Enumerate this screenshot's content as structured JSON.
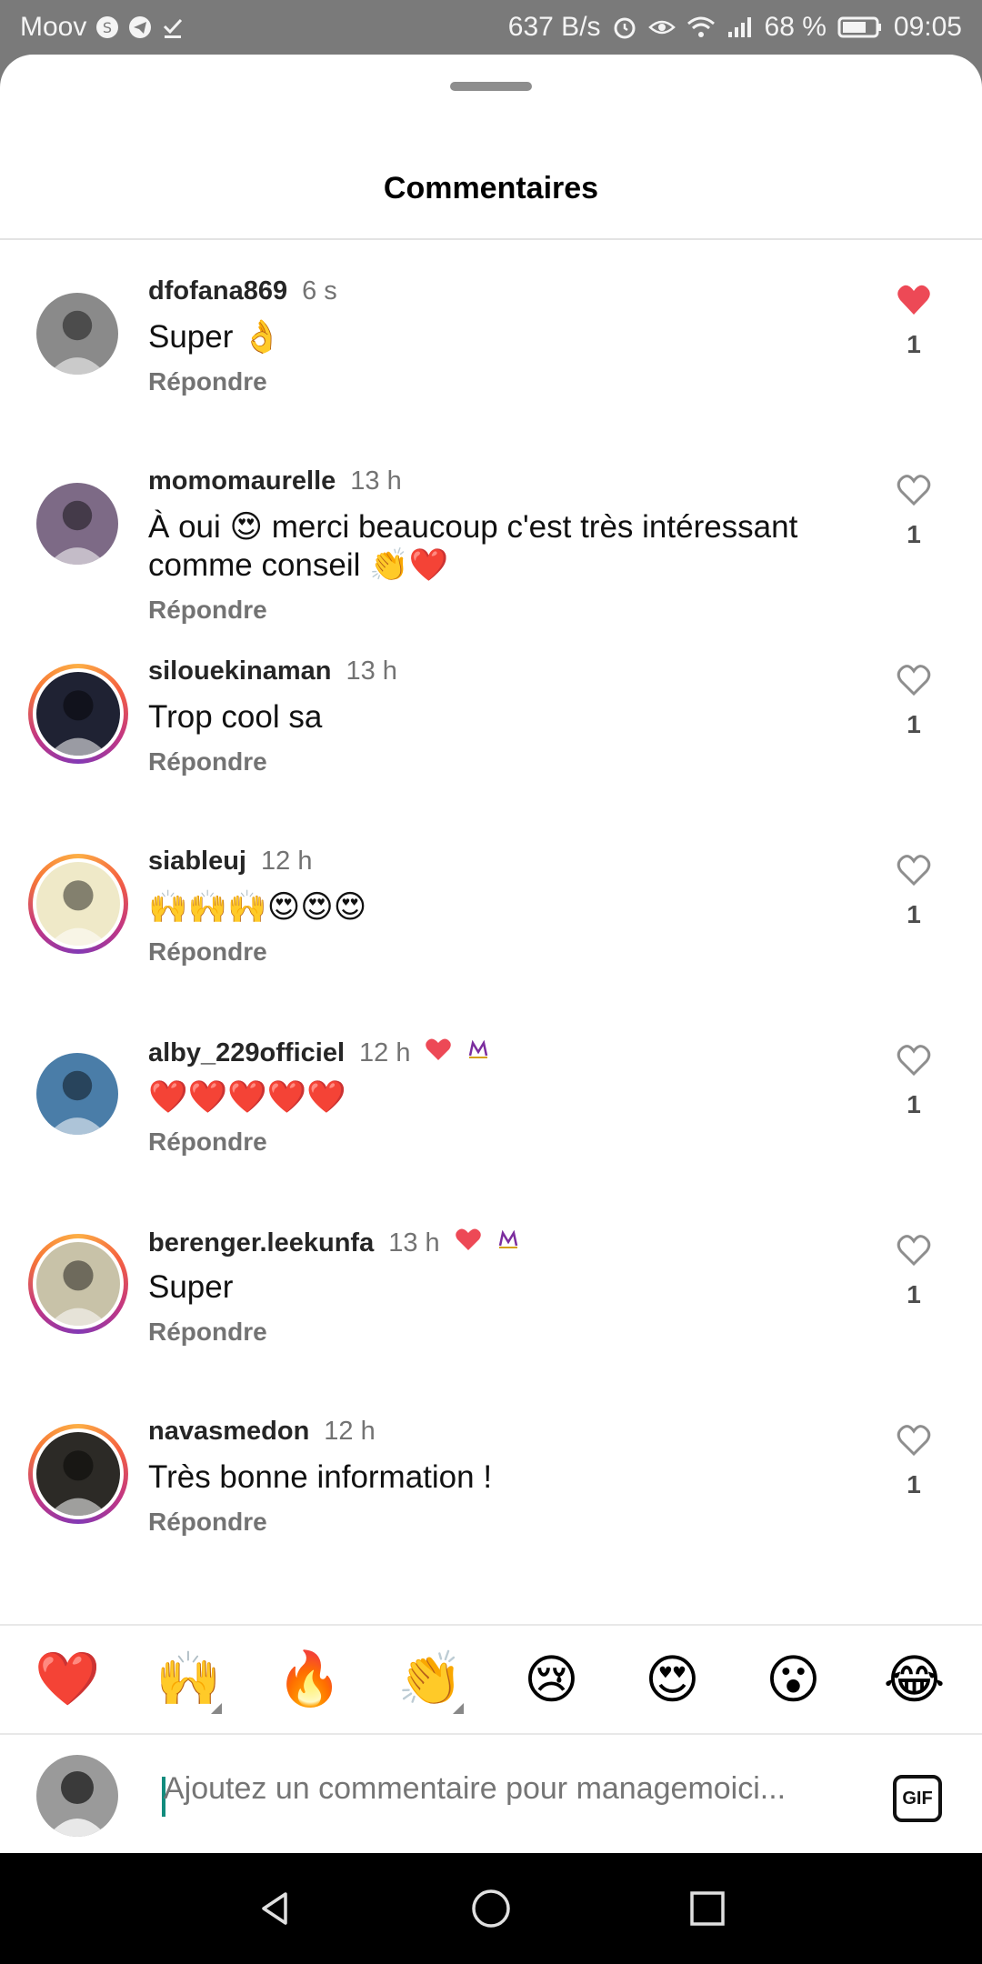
{
  "status_bar": {
    "carrier": "Moov",
    "net_speed": "637 B/s",
    "battery": "68 %",
    "time": "09:05"
  },
  "sheet": {
    "title": "Commentaires"
  },
  "comments": [
    {
      "username": "dfofana869",
      "time": "6 s",
      "text": "Super 👌",
      "reply": "Répondre",
      "likes": "1",
      "liked": true,
      "ring": false,
      "badges": false,
      "avatar_color": "#8a8a8a"
    },
    {
      "username": "momomaurelle",
      "time": "13 h",
      "text": "À oui 😍 merci beaucoup c'est très intéressant comme conseil 👏❤️",
      "reply": "Répondre",
      "likes": "1",
      "liked": false,
      "ring": false,
      "badges": false,
      "avatar_color": "#7d6a86"
    },
    {
      "username": "silouekinaman",
      "time": "13 h",
      "text": "Trop cool sa",
      "reply": "Répondre",
      "likes": "1",
      "liked": false,
      "ring": true,
      "badges": false,
      "avatar_color": "#1f2233"
    },
    {
      "username": "siableuj",
      "time": "12 h",
      "text": "🙌🙌🙌😍😍😍",
      "reply": "Répondre",
      "likes": "1",
      "liked": false,
      "ring": true,
      "badges": false,
      "avatar_color": "#efe9c8"
    },
    {
      "username": "alby_229officiel",
      "time": "12 h",
      "text": "❤️❤️❤️❤️❤️",
      "reply": "Répondre",
      "likes": "1",
      "liked": false,
      "ring": false,
      "badges": true,
      "avatar_color": "#4a7da8"
    },
    {
      "username": "berenger.leekunfa",
      "time": "13 h",
      "text": "Super",
      "reply": "Répondre",
      "likes": "1",
      "liked": false,
      "ring": true,
      "badges": true,
      "avatar_color": "#c8c2a8"
    },
    {
      "username": "navasmedon",
      "time": "12 h",
      "text": "Très bonne information !",
      "reply": "Répondre",
      "likes": "1",
      "liked": false,
      "ring": true,
      "badges": false,
      "avatar_color": "#2c2a26"
    }
  ],
  "emoji_bar": [
    "❤️",
    "🙌",
    "🔥",
    "👏",
    "😢",
    "😍",
    "😮",
    "😂"
  ],
  "input": {
    "placeholder": "Ajoutez un commentaire pour managemoici...",
    "gif_label": "GIF"
  },
  "colors": {
    "liked_heart": "#ed4956",
    "ring_gradient": [
      "#fcaf45",
      "#f56040",
      "#c13584",
      "#833ab4"
    ],
    "username": "#262626",
    "meta": "#737373"
  }
}
